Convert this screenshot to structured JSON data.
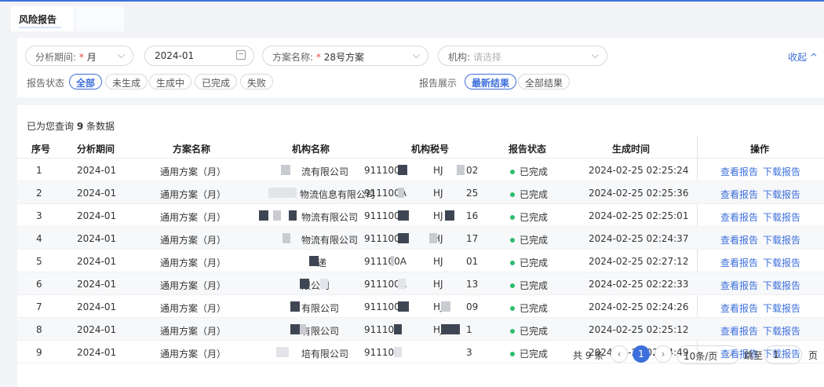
{
  "tabs": [
    {
      "label": "风险报告"
    }
  ],
  "filters": {
    "period": {
      "label": "分析期间:",
      "required": "*",
      "value": "月"
    },
    "date": {
      "value": "2024-01"
    },
    "plan": {
      "label": "方案名称:",
      "required": "*",
      "value": "28号方案"
    },
    "org": {
      "label": "机构:",
      "placeholder": "请选择"
    },
    "collapse_label": "收起 ^",
    "status_label": "报告状态",
    "status_options": [
      "全部",
      "未生成",
      "生成中",
      "已完成",
      "失败"
    ],
    "status_selected": "全部",
    "display_label": "报告展示",
    "display_options": [
      "最新结果",
      "全部结果"
    ],
    "display_selected": "最新结果"
  },
  "summary": {
    "prefix": "已为您查询",
    "count": "9",
    "suffix": "条数据"
  },
  "table": {
    "columns": [
      "序号",
      "分析期间",
      "方案名称",
      "机构名称",
      "机构税号",
      "报告状态",
      "生成时间",
      "操作"
    ],
    "rows": [
      {
        "no": "1",
        "period": "2024-01",
        "plan": "通用方案（月）",
        "org": "流有限公司",
        "tax": "911100A",
        "tax_mid": "HJ",
        "tax_end": "02",
        "status": "已完成",
        "time": "2024-02-25 02:25:24"
      },
      {
        "no": "2",
        "period": "2024-01",
        "plan": "通用方案（月）",
        "org": "物流信息有限公司",
        "tax": "911100A",
        "tax_mid": "HJ",
        "tax_end": "25",
        "status": "已完成",
        "time": "2024-02-25 02:25:36"
      },
      {
        "no": "3",
        "period": "2024-01",
        "plan": "通用方案（月）",
        "org": "物流有限公司",
        "tax": "911100A",
        "tax_mid": "HJ",
        "tax_end": "16",
        "status": "已完成",
        "time": "2024-02-25 02:25:01"
      },
      {
        "no": "4",
        "period": "2024-01",
        "plan": "通用方案（月）",
        "org": "物流有限公司",
        "tax": "911100A",
        "tax_mid": "HJ",
        "tax_end": "17",
        "status": "已完成",
        "time": "2024-02-25 02:24:37"
      },
      {
        "no": "5",
        "period": "2024-01",
        "plan": "通用方案（月）",
        "org": "递",
        "tax": "911100A",
        "tax_mid": "HJ",
        "tax_end": "01",
        "status": "已完成",
        "time": "2024-02-25 02:27:12"
      },
      {
        "no": "6",
        "period": "2024-01",
        "plan": "通用方案（月）",
        "org": "限公司",
        "tax": "911100A",
        "tax_mid": "HJ",
        "tax_end": "13",
        "status": "已完成",
        "time": "2024-02-25 02:22:33"
      },
      {
        "no": "7",
        "period": "2024-01",
        "plan": "通用方案（月）",
        "org": "有限公司",
        "tax": "911100A",
        "tax_mid": "HJ",
        "tax_end": "09",
        "status": "已完成",
        "time": "2024-02-25 02:24:26"
      },
      {
        "no": "8",
        "period": "2024-01",
        "plan": "通用方案（月）",
        "org": "有限公司",
        "tax": "91110",
        "tax_mid": "HJ",
        "tax_end": "1",
        "status": "已完成",
        "time": "2024-02-25 02:25:12"
      },
      {
        "no": "9",
        "period": "2024-01",
        "plan": "通用方案（月）",
        "org": "培有限公司",
        "tax": "91110",
        "tax_mid": "",
        "tax_end": "3",
        "status": "已完成",
        "time": "2024-02-25 02:24:49"
      }
    ],
    "actions": {
      "view": "查看报告",
      "download": "下载报告"
    }
  },
  "pagination": {
    "total": "共 9 条",
    "current_page": "1",
    "page_size": "10条/页",
    "jump_label": "跳至",
    "jump_value": "1",
    "page_unit": "页"
  },
  "colors": {
    "accent": "#3d6fdb",
    "success": "#2ebb6e"
  }
}
